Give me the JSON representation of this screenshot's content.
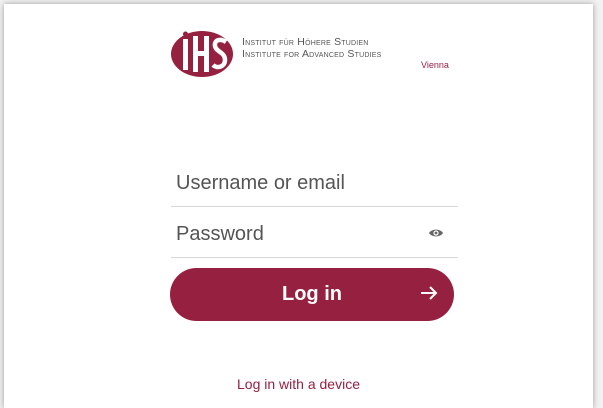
{
  "brand": {
    "logo_icon": "ihs-logo-icon",
    "name_de": "Institut für Höhere Studien",
    "name_en": "Institute for Advanced Studies",
    "city": "Vienna",
    "accent_color": "#96203f"
  },
  "form": {
    "username_placeholder": "Username or email",
    "username_value": "",
    "password_placeholder": "Password",
    "password_value": "",
    "show_password_icon": "eye-icon",
    "login_label": "Log in",
    "login_icon": "arrow-right-icon"
  },
  "footer": {
    "device_link": "Log in with a device"
  }
}
